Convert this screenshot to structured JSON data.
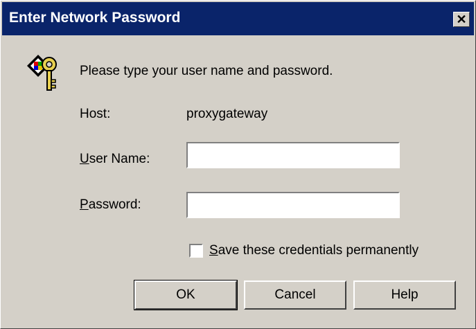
{
  "dialog": {
    "title": "Enter Network Password",
    "close_glyph": "✕",
    "prompt": "Please type your user name and password.",
    "host_label": "Host:",
    "host_value": "proxygateway",
    "username_label_access": "U",
    "username_label_rest": "ser Name:",
    "username_value": "",
    "password_label_access": "P",
    "password_label_rest": "assword:",
    "password_value": "",
    "save_label_access": "S",
    "save_label_rest": "ave these credentials permanently",
    "save_checked": false,
    "buttons": {
      "ok": "OK",
      "cancel": "Cancel",
      "help": "Help"
    },
    "icon": "keys-icon"
  }
}
